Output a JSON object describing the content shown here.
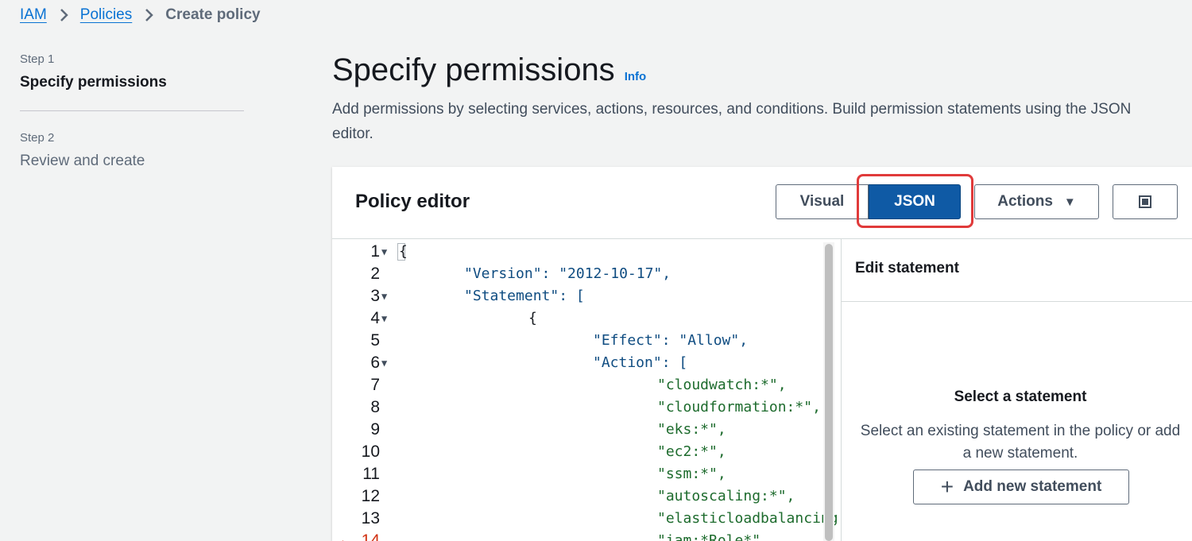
{
  "breadcrumb": {
    "items": [
      "IAM",
      "Policies"
    ],
    "current": "Create policy"
  },
  "steps": [
    {
      "label": "Step 1",
      "title": "Specify permissions"
    },
    {
      "label": "Step 2",
      "title": "Review and create"
    }
  ],
  "header": {
    "title": "Specify permissions",
    "info": "Info",
    "description": "Add permissions by selecting services, actions, resources, and conditions. Build permission statements using the JSON editor."
  },
  "editor": {
    "title": "Policy editor",
    "buttons": {
      "visual": "Visual",
      "json": "JSON",
      "actions": "Actions"
    },
    "code_lines": [
      {
        "n": "1",
        "text": "{"
      },
      {
        "n": "2",
        "text": "\"Version\": \"2012-10-17\","
      },
      {
        "n": "3",
        "text": "\"Statement\": ["
      },
      {
        "n": "4",
        "text": "{"
      },
      {
        "n": "5",
        "text": "\"Effect\": \"Allow\","
      },
      {
        "n": "6",
        "text": "\"Action\": ["
      },
      {
        "n": "7",
        "text": "\"cloudwatch:*\","
      },
      {
        "n": "8",
        "text": "\"cloudformation:*\","
      },
      {
        "n": "9",
        "text": "\"eks:*\","
      },
      {
        "n": "10",
        "text": "\"ec2:*\","
      },
      {
        "n": "11",
        "text": "\"ssm:*\","
      },
      {
        "n": "12",
        "text": "\"autoscaling:*\","
      },
      {
        "n": "13",
        "text": "\"elasticloadbalancing"
      },
      {
        "n": "14",
        "text": "\"iam:*Role*\","
      }
    ]
  },
  "statement_panel": {
    "title": "Edit statement",
    "empty_title": "Select a statement",
    "empty_desc": "Select an existing statement in the policy or add a new statement.",
    "add_button": "Add new statement"
  },
  "colors": {
    "primary": "#0f5aa5",
    "link": "#0972d3",
    "highlight": "#e03a3a",
    "warning": "#d13212"
  }
}
